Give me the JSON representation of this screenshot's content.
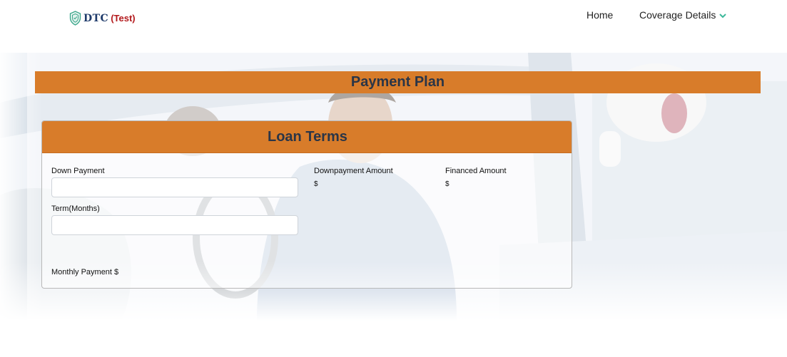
{
  "navbar": {
    "brand_name": "DTC",
    "brand_env": "(Test)",
    "links": {
      "home": "Home",
      "coverage": "Coverage Details"
    }
  },
  "payment_plan": {
    "title": "Payment Plan"
  },
  "loan_terms": {
    "title": "Loan Terms",
    "down_payment": {
      "label": "Down Payment",
      "value": "",
      "placeholder": ""
    },
    "term_months": {
      "label": "Term(Months)",
      "value": "",
      "placeholder": ""
    },
    "downpayment_amount": {
      "label": "Downpayment Amount",
      "value": "$"
    },
    "financed_amount": {
      "label": "Financed Amount",
      "value": "$"
    },
    "monthly_payment": {
      "label": "Monthly Payment $"
    }
  },
  "icons": {
    "brand": "shield-logo-icon",
    "coverage_dropdown": "chevron-down-icon"
  },
  "colors": {
    "accent_orange": "#d87c2a",
    "heading_text": "#2a3547",
    "brand_blue": "#1f3b6b",
    "brand_red": "#b3191c",
    "chevron_teal": "#3cb89a"
  }
}
